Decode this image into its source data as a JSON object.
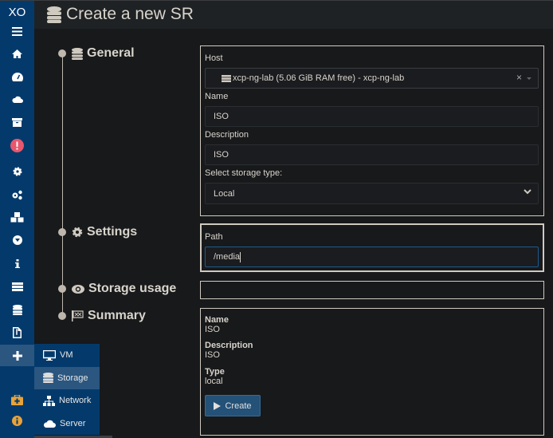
{
  "app": {
    "logo": "XO",
    "title": "Create a new SR"
  },
  "sidebar": {
    "items": [
      {
        "icon": "menu-icon"
      },
      {
        "icon": "home-icon"
      },
      {
        "icon": "dashboard-icon"
      },
      {
        "icon": "cloud-icon"
      },
      {
        "icon": "archive-icon"
      },
      {
        "icon": "alert-icon"
      },
      {
        "icon": "gear-icon"
      },
      {
        "icon": "gears-icon"
      },
      {
        "icon": "cubes-icon"
      },
      {
        "icon": "globe-icon"
      },
      {
        "icon": "info-icon"
      },
      {
        "icon": "tasks-icon"
      },
      {
        "icon": "database-icon"
      },
      {
        "icon": "file-archive-icon"
      },
      {
        "icon": "plus-icon"
      },
      {
        "icon": "medkit-icon"
      },
      {
        "icon": "info-circle-icon"
      }
    ]
  },
  "submenu": {
    "items": [
      {
        "label": "VM",
        "icon": "monitor-icon"
      },
      {
        "label": "Storage",
        "icon": "database-icon"
      },
      {
        "label": "Network",
        "icon": "sitemap-icon"
      },
      {
        "label": "Server",
        "icon": "cloud-icon"
      }
    ]
  },
  "steps": {
    "general": "General",
    "settings": "Settings",
    "storage_usage": "Storage usage",
    "summary": "Summary"
  },
  "general": {
    "host_label": "Host",
    "host_value": "xcp-ng-lab (5.06 GiB RAM free) - xcp-ng-lab",
    "clear_glyph": "×",
    "name_label": "Name",
    "name_value": "ISO",
    "description_label": "Description",
    "description_value": "ISO",
    "type_label": "Select storage type:",
    "type_value": "Local"
  },
  "settings": {
    "path_label": "Path",
    "path_value": "/media"
  },
  "summary": {
    "name_label": "Name",
    "name_value": "ISO",
    "description_label": "Description",
    "description_value": "ISO",
    "type_label": "Type",
    "type_value": "local",
    "create_label": "Create"
  },
  "colors": {
    "sidebar": "#043a6b",
    "accent_button": "#245177",
    "alert": "#e8576d",
    "warning": "#e8a33a"
  }
}
